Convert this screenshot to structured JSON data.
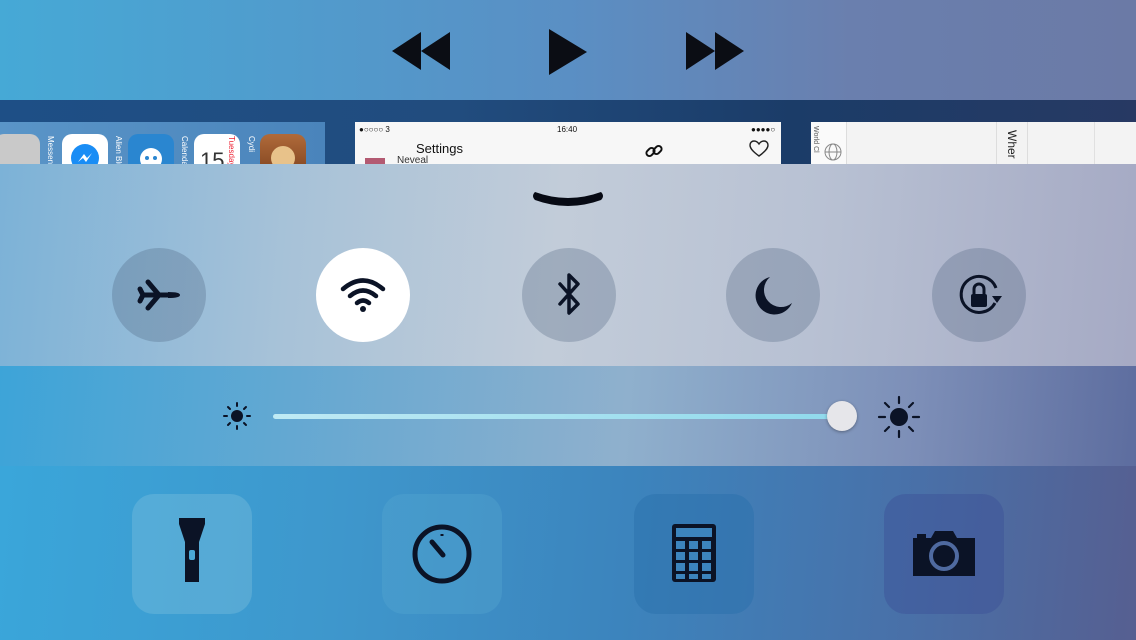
{
  "media": {
    "rewind_icon": "rewind-icon",
    "play_icon": "play-icon",
    "fast_forward_icon": "fast-forward-icon"
  },
  "app_switcher": {
    "home_labels": [
      "Messeng",
      "Alien Blue",
      "Calendar",
      "Tuesday",
      "15",
      "Cydi"
    ],
    "settings": {
      "carrier": "●○○○○ 3",
      "time": "16:40",
      "title": "Settings",
      "subtitle": "Neveal",
      "right_signal": "●●●●○"
    },
    "clock": {
      "world_clock_label": "World Cl",
      "where_label": "Wher"
    }
  },
  "controls": {
    "toggles": [
      {
        "name": "airplane-mode",
        "icon": "airplane-icon",
        "on": false
      },
      {
        "name": "wifi",
        "icon": "wifi-icon",
        "on": true
      },
      {
        "name": "bluetooth",
        "icon": "bluetooth-icon",
        "on": false
      },
      {
        "name": "do-not-disturb",
        "icon": "moon-icon",
        "on": false
      },
      {
        "name": "rotation-lock",
        "icon": "rotation-lock-icon",
        "on": false
      }
    ],
    "brightness": {
      "level": 0.99
    }
  },
  "tools": [
    {
      "name": "flashlight",
      "icon": "flashlight-icon"
    },
    {
      "name": "timer",
      "icon": "timer-icon"
    },
    {
      "name": "calculator",
      "icon": "calculator-icon"
    },
    {
      "name": "camera",
      "icon": "camera-icon"
    }
  ],
  "colors": {
    "toggle_on": "#ffffff",
    "icon_dark": "#0b1326",
    "tool_icon": "#0b1326",
    "slider_fill": "#9fdff0"
  }
}
